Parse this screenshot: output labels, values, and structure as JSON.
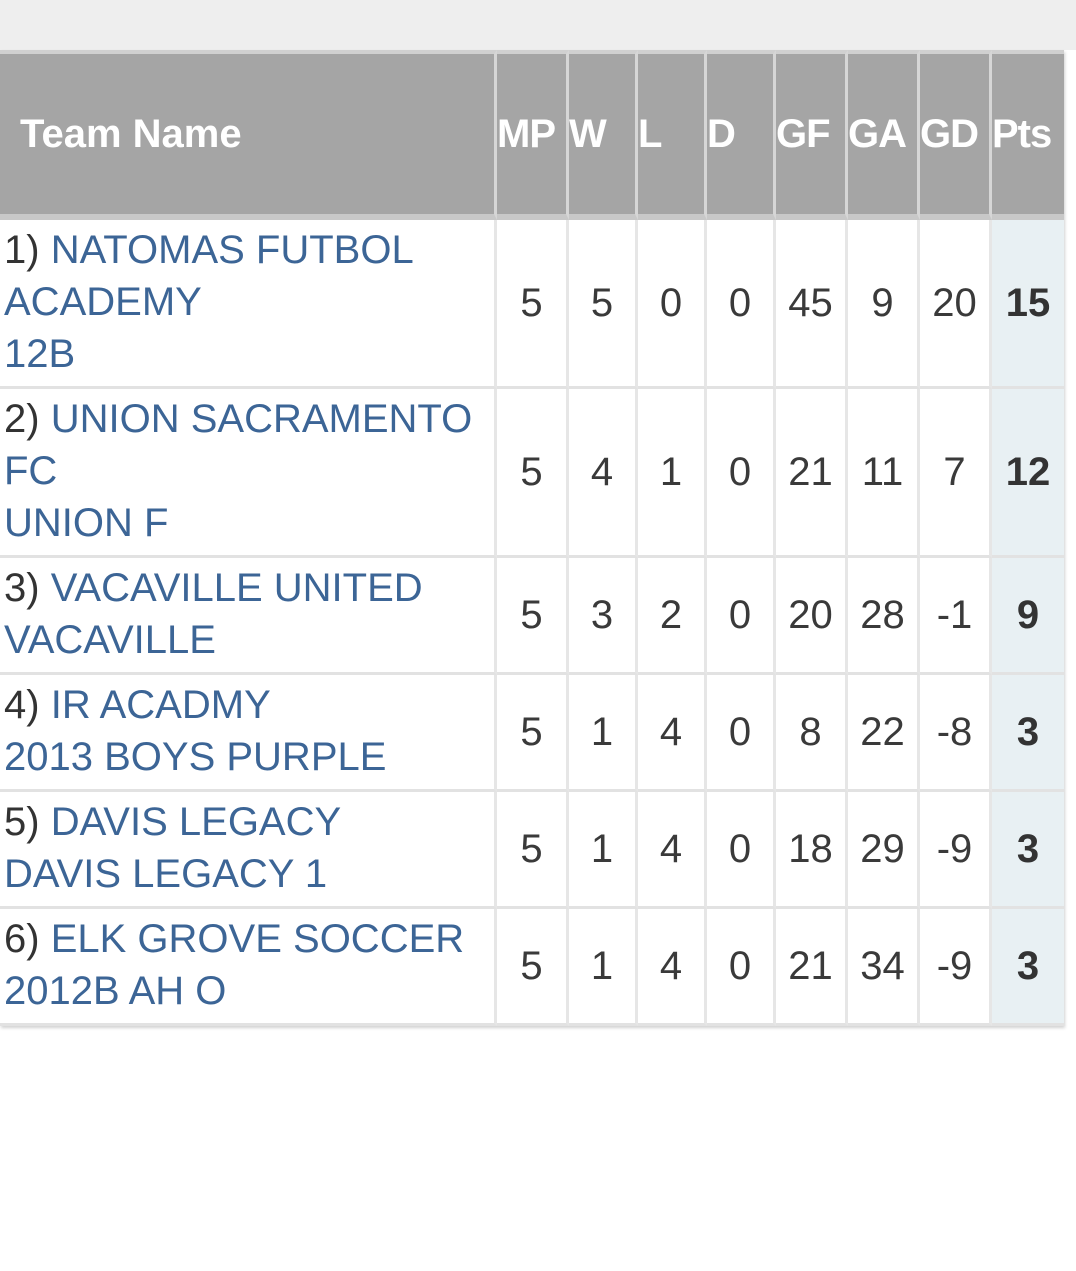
{
  "header": {
    "team_name": "Team Name",
    "mp": "MP",
    "w": "W",
    "l": "L",
    "d": "D",
    "gf": "GF",
    "ga": "GA",
    "gd": "GD",
    "pts": "Pts"
  },
  "rows": [
    {
      "rank": "1)",
      "club": "NATOMAS FUTBOL ACADEMY",
      "team": "12B",
      "mp": "5",
      "w": "5",
      "l": "0",
      "d": "0",
      "gf": "45",
      "ga": "9",
      "gd": "20",
      "pts": "15"
    },
    {
      "rank": "2)",
      "club": "UNION SACRAMENTO FC",
      "team": "UNION F",
      "mp": "5",
      "w": "4",
      "l": "1",
      "d": "0",
      "gf": "21",
      "ga": "11",
      "gd": "7",
      "pts": "12"
    },
    {
      "rank": "3)",
      "club": "VACAVILLE UNITED",
      "team": "VACAVILLE",
      "mp": "5",
      "w": "3",
      "l": "2",
      "d": "0",
      "gf": "20",
      "ga": "28",
      "gd": "-1",
      "pts": "9"
    },
    {
      "rank": "4)",
      "club": "IR ACADMY",
      "team": "2013 BOYS PURPLE",
      "mp": "5",
      "w": "1",
      "l": "4",
      "d": "0",
      "gf": "8",
      "ga": "22",
      "gd": "-8",
      "pts": "3"
    },
    {
      "rank": "5)",
      "club": "DAVIS LEGACY",
      "team": "DAVIS LEGACY 1",
      "mp": "5",
      "w": "1",
      "l": "4",
      "d": "0",
      "gf": "18",
      "ga": "29",
      "gd": "-9",
      "pts": "3"
    },
    {
      "rank": "6)",
      "club": "ELK GROVE SOCCER",
      "team": "2012B AH O",
      "mp": "5",
      "w": "1",
      "l": "4",
      "d": "0",
      "gf": "21",
      "ga": "34",
      "gd": "-9",
      "pts": "3"
    }
  ],
  "colors": {
    "header_bg": "#a5a5a5",
    "link": "#3c6596",
    "pts_bg": "#e8f0f3"
  }
}
